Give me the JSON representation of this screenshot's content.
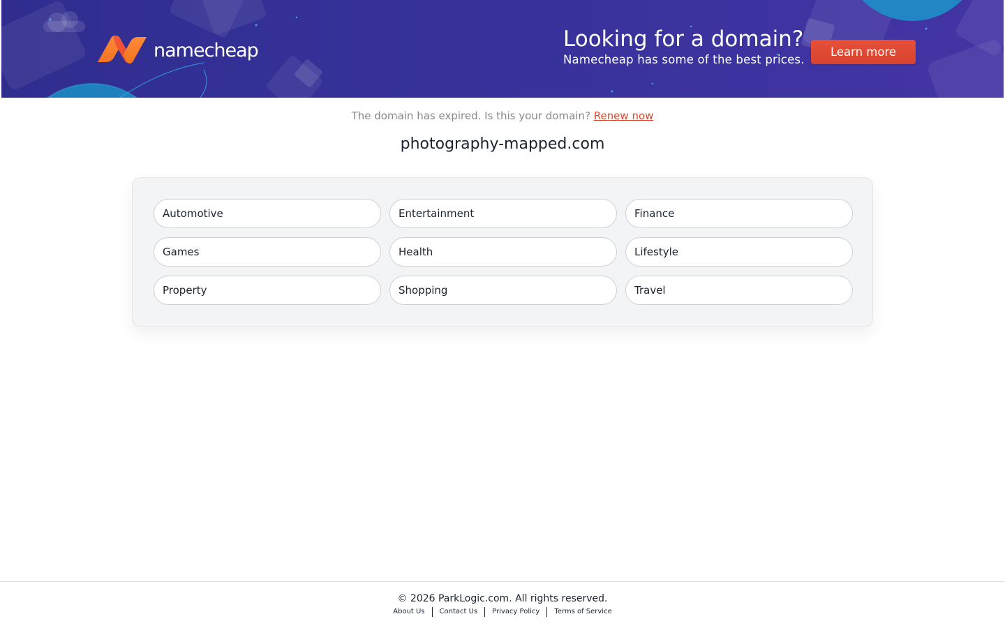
{
  "banner": {
    "brand": "namecheap",
    "headline": "Looking for a domain?",
    "subline": "Namecheap has some of the best prices.",
    "cta_label": "Learn more"
  },
  "notice": {
    "text": "The domain has expired. Is this your domain?",
    "link_label": "Renew now"
  },
  "domain": "photography-mapped.com",
  "categories": [
    "Automotive",
    "Entertainment",
    "Finance",
    "Games",
    "Health",
    "Lifestyle",
    "Property",
    "Shopping",
    "Travel"
  ],
  "footer": {
    "copyright": "© 2026 ParkLogic.com. All rights reserved.",
    "links": [
      "About Us",
      "Contact Us",
      "Privacy Policy",
      "Terms of Service"
    ]
  },
  "colors": {
    "banner_bg": "#36329a",
    "accent": "#e6503a",
    "link": "#d64a2f",
    "panel_bg": "#f3f4f6"
  }
}
